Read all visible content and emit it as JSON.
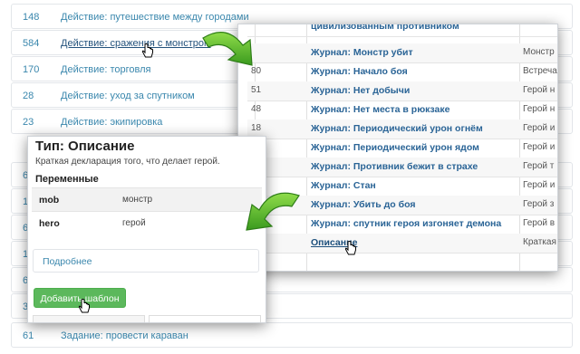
{
  "background_list": [
    {
      "count": "148",
      "label": "Действие: путешествие между городами"
    },
    {
      "count": "584",
      "label": "Действие: сражения с монстром"
    },
    {
      "count": "170",
      "label": "Действие: торговля"
    },
    {
      "count": "28",
      "label": "Действие: уход за спутником"
    },
    {
      "count": "23",
      "label": "Действие: экипировка"
    },
    {
      "count": "6",
      "label": ""
    },
    {
      "count": "1",
      "label": ""
    },
    {
      "count": "6",
      "label": ""
    },
    {
      "count": "1",
      "label": ""
    },
    {
      "count": "6",
      "label": ""
    },
    {
      "count": "3",
      "label": ""
    },
    {
      "count": "61",
      "label": "Задание: провести караван"
    }
  ],
  "right_panel": {
    "rows": [
      {
        "num": "",
        "name": "цивилизованным противником",
        "desc": ""
      },
      {
        "num": "",
        "name": "Журнал: Монстр убит",
        "desc": "Монстр"
      },
      {
        "num": "80",
        "name": "Журнал: Начало боя",
        "desc": "Встреча"
      },
      {
        "num": "51",
        "name": "Журнал: Нет добычи",
        "desc": "Герой н"
      },
      {
        "num": "48",
        "name": "Журнал: Нет места в рюкзаке",
        "desc": "Герой н"
      },
      {
        "num": "18",
        "name": "Журнал: Периодический урон огнём",
        "desc": "Герой и"
      },
      {
        "num": "18",
        "name": "Журнал: Периодический урон ядом",
        "desc": "Герой и"
      },
      {
        "num": "",
        "name": "Журнал: Противник бежит в страхе",
        "desc": "Герой т"
      },
      {
        "num": "",
        "name": "Журнал: Стан",
        "desc": "Герой и"
      },
      {
        "num": "",
        "name": "Журнал: Убить до боя",
        "desc": "Герой з"
      },
      {
        "num": "",
        "name": "Журнал: спутник героя изгоняет демона",
        "desc": "Герой в"
      },
      {
        "num": "",
        "name": "Описание",
        "desc": "Краткая"
      }
    ]
  },
  "left_panel": {
    "title": "Тип: Описание",
    "description": "Краткая декларация того, что делает герой.",
    "variables_heading": "Переменные",
    "variables": [
      {
        "key": "mob",
        "value": "монстр"
      },
      {
        "key": "hero",
        "value": "герой"
      }
    ],
    "more_link": "Подробнее",
    "add_button": "Добавить шаблон"
  },
  "colors": {
    "arrow_green": "#4caf2a",
    "link_blue": "#3a87ad",
    "button_green": "#5cb85c"
  },
  "icons": [
    "hand-cursor-icon",
    "curved-arrow-icon"
  ]
}
